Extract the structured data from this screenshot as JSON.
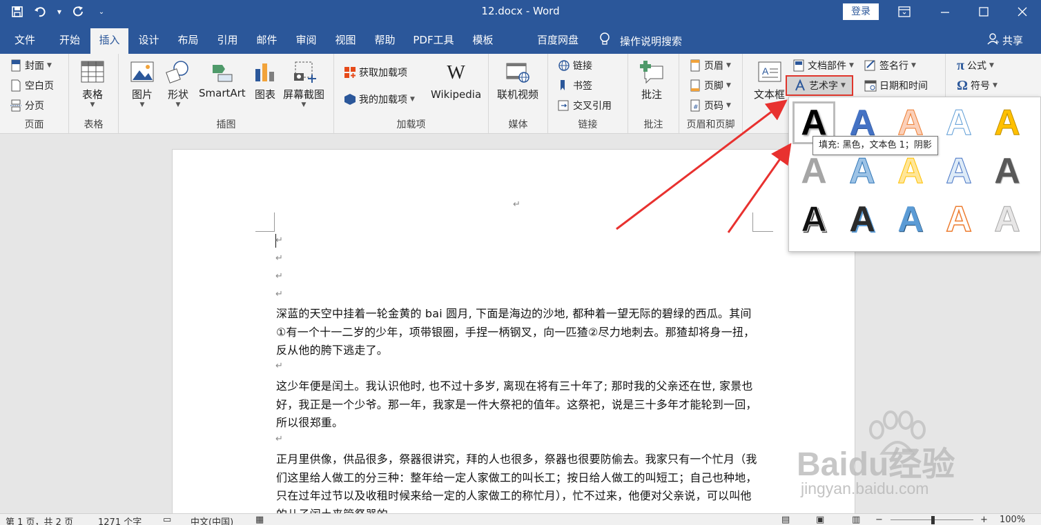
{
  "titlebar": {
    "title": "12.docx  -  Word",
    "login": "登录",
    "ribbon_display_icon": "ribbon-display-icon",
    "minimize_icon": "minimize-icon",
    "maximize_icon": "maximize-icon",
    "close_icon": "close-icon"
  },
  "qat": [
    "save-icon",
    "undo-icon",
    "redo-icon",
    "customize-icon"
  ],
  "tabs": [
    {
      "label": "文件"
    },
    {
      "label": "开始"
    },
    {
      "label": "插入"
    },
    {
      "label": "设计"
    },
    {
      "label": "布局"
    },
    {
      "label": "引用"
    },
    {
      "label": "邮件"
    },
    {
      "label": "审阅"
    },
    {
      "label": "视图"
    },
    {
      "label": "帮助"
    },
    {
      "label": "PDF工具"
    },
    {
      "label": "模板"
    },
    {
      "label": "百度网盘"
    }
  ],
  "tell_me": "操作说明搜索",
  "share": "共享",
  "ribbon": {
    "pages": {
      "cover": "封面",
      "blank": "空白页",
      "break": "分页",
      "label": "页面"
    },
    "tables": {
      "table": "表格",
      "label": "表格"
    },
    "illustrations": {
      "picture": "图片",
      "shapes": "形状",
      "smartart": "SmartArt",
      "chart": "图表",
      "screenshot": "屏幕截图",
      "label": "插图"
    },
    "addins": {
      "get": "获取加载项",
      "my": "我的加载项",
      "wiki": "Wikipedia",
      "label": "加载项"
    },
    "media": {
      "video": "联机视频",
      "label": "媒体"
    },
    "links": {
      "link": "链接",
      "bookmark": "书签",
      "crossref": "交叉引用",
      "label": "链接"
    },
    "comments": {
      "comment": "批注",
      "label": "批注"
    },
    "header_footer": {
      "header": "页眉",
      "footer": "页脚",
      "page_number": "页码",
      "label": "页眉和页脚"
    },
    "text": {
      "textbox": "文本框",
      "quick_parts": "文档部件",
      "wordart": "艺术字",
      "signature": "签名行",
      "datetime": "日期和时间"
    },
    "symbols": {
      "equation": "公式",
      "symbol": "符号"
    }
  },
  "tooltip": "填充: 黑色，文本色 1；阴影",
  "wordart_glyph": "A",
  "document": {
    "paragraphs": [
      "深蓝的天空中挂着一轮金黄的 bai 圆月, 下面是海边的沙地, 都种着一望无际的碧绿的西瓜。其间①有一个十一二岁的少年，项带银圈，手捏一柄钢叉，向一匹猹②尽力地刺去。那猹却将身一扭，反从他的胯下逃走了。",
      "这少年便是闰土。我认识他时, 也不过十多岁, 离现在将有三十年了; 那时我的父亲还在世, 家景也好，我正是一个少爷。那一年，我家是一件大祭祀的值年。这祭祀，说是三十多年才能轮到一回，所以很郑重。",
      "正月里供像，供品很多，祭器很讲究，拜的人也很多，祭器也很要防偷去。我家只有一个忙月（我们这里给人做工的分三种：整年给一定人家做工的叫长工；按日给人做工的叫短工；自己也种地，只在过年过节以及收租时候来给一定的人家做工的称忙月），忙不过来，他便对父亲说，可以叫他的儿子闰土来管祭器的。"
    ],
    "para_mark": "↵"
  },
  "status": {
    "page": "第 1 页，共 2 页",
    "words": "1271 个字",
    "lang": "中文(中国)",
    "zoom": "100%"
  },
  "watermark": {
    "brand": "Baidu经验",
    "url": "jingyan.baidu.com"
  },
  "colors": {
    "accent": "#2b579a",
    "arrow": "#e8312f"
  }
}
